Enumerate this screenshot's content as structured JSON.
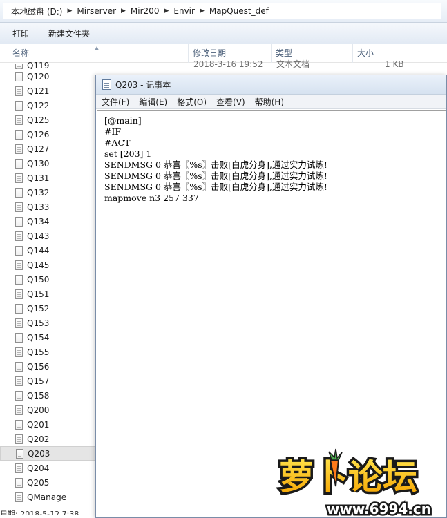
{
  "explorer": {
    "breadcrumb": [
      "本地磁盘 (D:)",
      "Mirserver",
      "Mir200",
      "Envir",
      "MapQuest_def"
    ],
    "toolbar": {
      "print": "打印",
      "new_folder": "新建文件夹"
    },
    "columns": {
      "name": "名称",
      "modified": "修改日期",
      "type": "类型",
      "size": "大小"
    },
    "first_row": {
      "name": "Q119",
      "date": "2018-3-16 19:52",
      "type": "文本文档",
      "size": "1 KB"
    },
    "files": [
      "Q120",
      "Q121",
      "Q122",
      "Q125",
      "Q126",
      "Q127",
      "Q130",
      "Q131",
      "Q132",
      "Q133",
      "Q134",
      "Q143",
      "Q144",
      "Q145",
      "Q150",
      "Q151",
      "Q152",
      "Q153",
      "Q154",
      "Q155",
      "Q156",
      "Q157",
      "Q158",
      "Q200",
      "Q201",
      "Q202",
      "Q203",
      "Q204",
      "Q205",
      "QManage"
    ],
    "selected_file": "Q203",
    "status": "日期: 2018-5-12 7:38"
  },
  "notepad": {
    "title": "Q203 - 记事本",
    "menu": [
      "文件(F)",
      "编辑(E)",
      "格式(O)",
      "查看(V)",
      "帮助(H)"
    ],
    "lines": [
      "[@main]",
      "#IF",
      "#ACT",
      "set [203] 1",
      "SENDMSG 0 恭喜〖%s〗击败[白虎分身],通过实力试炼!",
      "SENDMSG 0 恭喜〖%s〗击败[白虎分身],通过实力试炼!",
      "SENDMSG 0 恭喜〖%s〗击败[白虎分身],通过实力试炼!",
      "mapmove n3 257 337"
    ]
  },
  "watermark": {
    "logo": "萝卜论坛",
    "url": "www.6994.cn"
  }
}
